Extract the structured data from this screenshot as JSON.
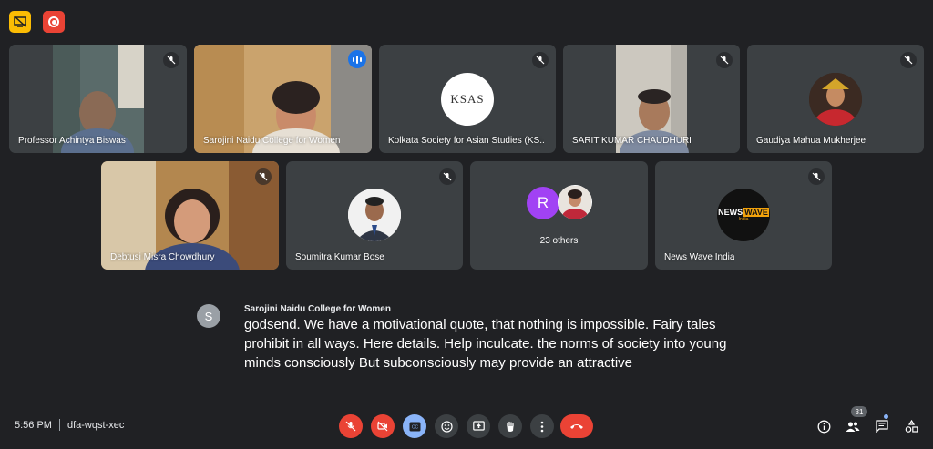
{
  "top_badges": [
    {
      "icon": "screen-share-off-icon",
      "color": "#fbbc04"
    },
    {
      "icon": "record-icon",
      "color": "#ea4335"
    }
  ],
  "participants": [
    {
      "name": "Professor Achintya Biswas",
      "muted": true,
      "display": "video"
    },
    {
      "name": "Sarojini Naidu College for Women",
      "muted": false,
      "speaking": true,
      "display": "video"
    },
    {
      "name": "Kolkata Society for Asian Studies (KS...",
      "muted": true,
      "display": "avatar",
      "logo_text": "KSAS"
    },
    {
      "name": "SARIT KUMAR CHAUDHURI",
      "muted": true,
      "display": "video"
    },
    {
      "name": "Gaudiya Mahua Mukherjee",
      "muted": true,
      "display": "avatar"
    },
    {
      "name": "Debtusi Misra Chowdhury",
      "muted": true,
      "display": "video"
    },
    {
      "name": "Soumitra Kumar Bose",
      "muted": true,
      "display": "avatar"
    },
    {
      "name": "23 others",
      "muted": false,
      "display": "others",
      "initial": "R"
    },
    {
      "name": "News Wave India",
      "muted": true,
      "display": "avatar",
      "logo_line1": "NEWS",
      "logo_line2": "WAVE",
      "logo_line3": "India"
    }
  ],
  "caption": {
    "initial": "S",
    "speaker": "Sarojini Naidu College for Women",
    "text": "godsend. We have a motivational quote, that nothing is impossible. Fairy tales prohibit in all ways. Here details. Help inculcate. the norms of society into young minds consciously But subconsciously may provide an attractive"
  },
  "meeting": {
    "time": "5:56 PM",
    "code": "dfa-wqst-xec"
  },
  "controls": [
    {
      "name": "microphone-off",
      "color": "#ea4335"
    },
    {
      "name": "camera-off",
      "color": "#ea4335"
    },
    {
      "name": "captions",
      "color": "#8ab4f8"
    },
    {
      "name": "reactions",
      "color": "#3c4043"
    },
    {
      "name": "present-screen",
      "color": "#3c4043"
    },
    {
      "name": "raise-hand",
      "color": "#3c4043"
    },
    {
      "name": "more-options",
      "color": "#3c4043"
    },
    {
      "name": "leave-call",
      "color": "#ea4335"
    }
  ],
  "side_controls": {
    "people_count": "31"
  }
}
